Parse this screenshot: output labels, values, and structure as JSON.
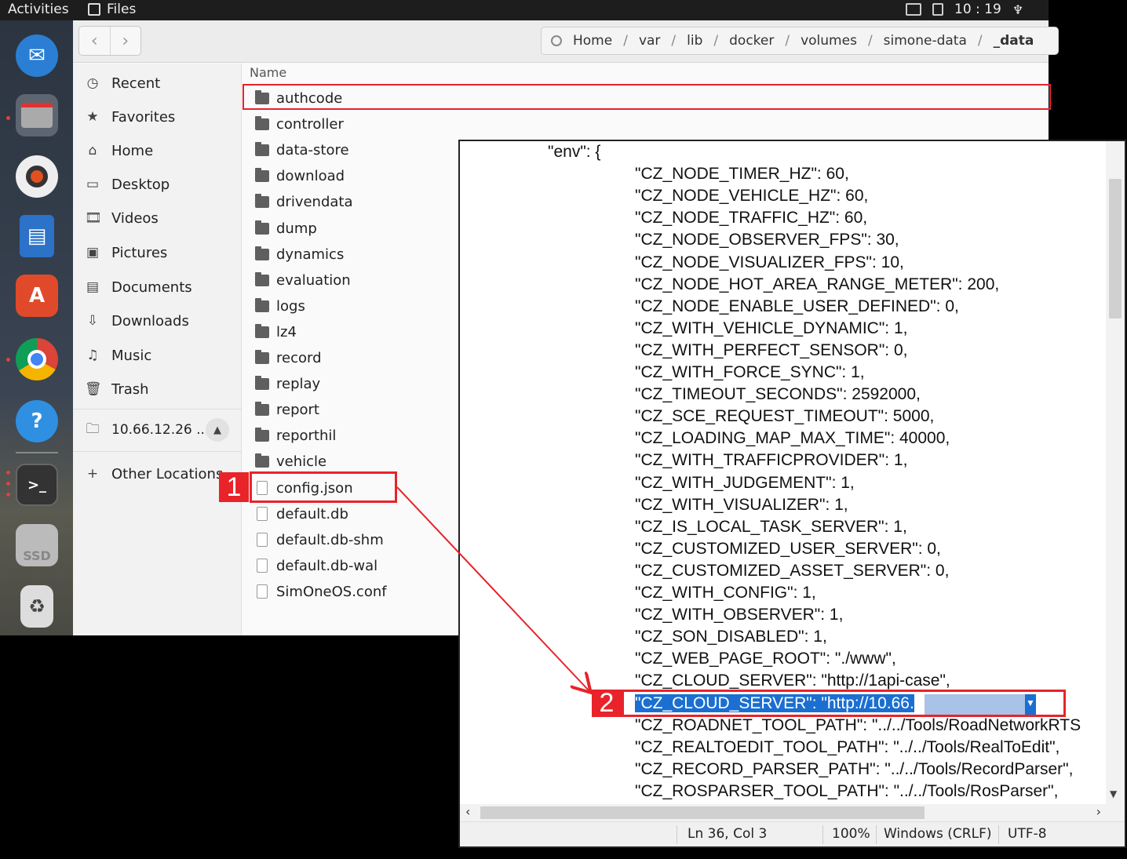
{
  "topbar": {
    "activities": "Activities",
    "app_name": "Files",
    "time": "10 : 19"
  },
  "dock": {
    "items": [
      {
        "name": "thunderbird",
        "icon": "mail-bird-icon",
        "color": "#2a7fd4"
      },
      {
        "name": "files",
        "icon": "files-drawer-icon",
        "color": "#8a8a8a"
      },
      {
        "name": "rhythmbox",
        "icon": "speaker-icon",
        "color": "#e05020"
      },
      {
        "name": "writer",
        "icon": "document-icon",
        "color": "#2b72c8"
      },
      {
        "name": "software",
        "icon": "app-store-icon",
        "color": "#e04a2a"
      },
      {
        "name": "chrome",
        "icon": "chrome-icon",
        "color": "#4285f4"
      },
      {
        "name": "help",
        "icon": "help-icon",
        "color": "#2f8fe0"
      },
      {
        "name": "terminal",
        "icon": "terminal-icon",
        "color": "#333"
      },
      {
        "name": "ssd",
        "icon": "drive-icon",
        "color": "#aaa",
        "label": "SSD"
      },
      {
        "name": "trash",
        "icon": "recycle-icon",
        "color": "#ccc"
      }
    ]
  },
  "path": {
    "crumbs": [
      "Home",
      "var",
      "lib",
      "docker",
      "volumes",
      "simone-data",
      "_data"
    ]
  },
  "sidebar": {
    "items": [
      {
        "label": "Recent",
        "icon": "clock-icon",
        "glyph": "◷"
      },
      {
        "label": "Favorites",
        "icon": "star-icon",
        "glyph": "★"
      },
      {
        "label": "Home",
        "icon": "home-icon",
        "glyph": "⌂"
      },
      {
        "label": "Desktop",
        "icon": "desktop-icon",
        "glyph": "▭"
      },
      {
        "label": "Videos",
        "icon": "film-icon",
        "glyph": "🎞"
      },
      {
        "label": "Pictures",
        "icon": "picture-icon",
        "glyph": "▣"
      },
      {
        "label": "Documents",
        "icon": "document-icon",
        "glyph": "▤"
      },
      {
        "label": "Downloads",
        "icon": "download-icon",
        "glyph": "⇩"
      },
      {
        "label": "Music",
        "icon": "music-icon",
        "glyph": "♫"
      },
      {
        "label": "Trash",
        "icon": "trash-icon",
        "glyph": "🗑"
      }
    ],
    "network": "10.66.12.26 ...",
    "other_locations": "Other Locations"
  },
  "filelist": {
    "column_header": "Name",
    "files": [
      {
        "name": "authcode",
        "type": "folder"
      },
      {
        "name": "controller",
        "type": "folder"
      },
      {
        "name": "data-store",
        "type": "folder"
      },
      {
        "name": "download",
        "type": "folder"
      },
      {
        "name": "drivendata",
        "type": "folder"
      },
      {
        "name": "dump",
        "type": "folder"
      },
      {
        "name": "dynamics",
        "type": "folder"
      },
      {
        "name": "evaluation",
        "type": "folder"
      },
      {
        "name": "logs",
        "type": "folder"
      },
      {
        "name": "lz4",
        "type": "folder"
      },
      {
        "name": "record",
        "type": "folder"
      },
      {
        "name": "replay",
        "type": "folder"
      },
      {
        "name": "report",
        "type": "folder"
      },
      {
        "name": "reporthil",
        "type": "folder"
      },
      {
        "name": "vehicle",
        "type": "folder"
      },
      {
        "name": "config.json",
        "type": "file"
      },
      {
        "name": "default.db",
        "type": "file"
      },
      {
        "name": "default.db-shm",
        "type": "file"
      },
      {
        "name": "default.db-wal",
        "type": "file"
      },
      {
        "name": "SimOneOS.conf",
        "type": "file"
      }
    ]
  },
  "editor": {
    "lines": [
      "\"env\": {",
      "\"CZ_NODE_TIMER_HZ\": 60,",
      "\"CZ_NODE_VEHICLE_HZ\": 60,",
      "\"CZ_NODE_TRAFFIC_HZ\": 60,",
      "\"CZ_NODE_OBSERVER_FPS\": 30,",
      "\"CZ_NODE_VISUALIZER_FPS\": 10,",
      "\"CZ_NODE_HOT_AREA_RANGE_METER\": 200,",
      "\"CZ_NODE_ENABLE_USER_DEFINED\": 0,",
      "\"CZ_WITH_VEHICLE_DYNAMIC\": 1,",
      "\"CZ_WITH_PERFECT_SENSOR\": 0,",
      "\"CZ_WITH_FORCE_SYNC\": 1,",
      "\"CZ_TIMEOUT_SECONDS\": 2592000,",
      "\"CZ_SCE_REQUEST_TIMEOUT\": 5000,",
      "\"CZ_LOADING_MAP_MAX_TIME\": 40000,",
      "\"CZ_WITH_TRAFFICPROVIDER\": 1,",
      "\"CZ_WITH_JUDGEMENT\": 1,",
      "\"CZ_WITH_VISUALIZER\": 1,",
      "\"CZ_IS_LOCAL_TASK_SERVER\": 1,",
      "\"CZ_CUSTOMIZED_USER_SERVER\": 0,",
      "\"CZ_CUSTOMIZED_ASSET_SERVER\": 0,",
      "\"CZ_WITH_CONFIG\": 1,",
      "\"CZ_WITH_OBSERVER\": 1,",
      "\"CZ_SON_DISABLED\": 1,",
      "\"CZ_WEB_PAGE_ROOT\": \"./www\",",
      "\"CZ_CLOUD_SERVER\": \"http://1api-case\",",
      "\"CZ_CLOUD_SERVER\": \"http://10.66.",
      "\"CZ_ROADNET_TOOL_PATH\": \"../../Tools/RoadNetworkRTS",
      "\"CZ_REALTOEDIT_TOOL_PATH\": \"../../Tools/RealToEdit\",",
      "\"CZ_RECORD_PARSER_PATH\": \"../../Tools/RecordParser\",",
      "\"CZ_ROSPARSER_TOOL_PATH\": \"../../Tools/RosParser\","
    ],
    "status": {
      "position": "Ln 36, Col 3",
      "zoom": "100%",
      "line_ending": "Windows (CRLF)",
      "encoding": "UTF-8"
    }
  },
  "annotations": {
    "step1": "1",
    "step2": "2",
    "color": "#e8232a"
  }
}
